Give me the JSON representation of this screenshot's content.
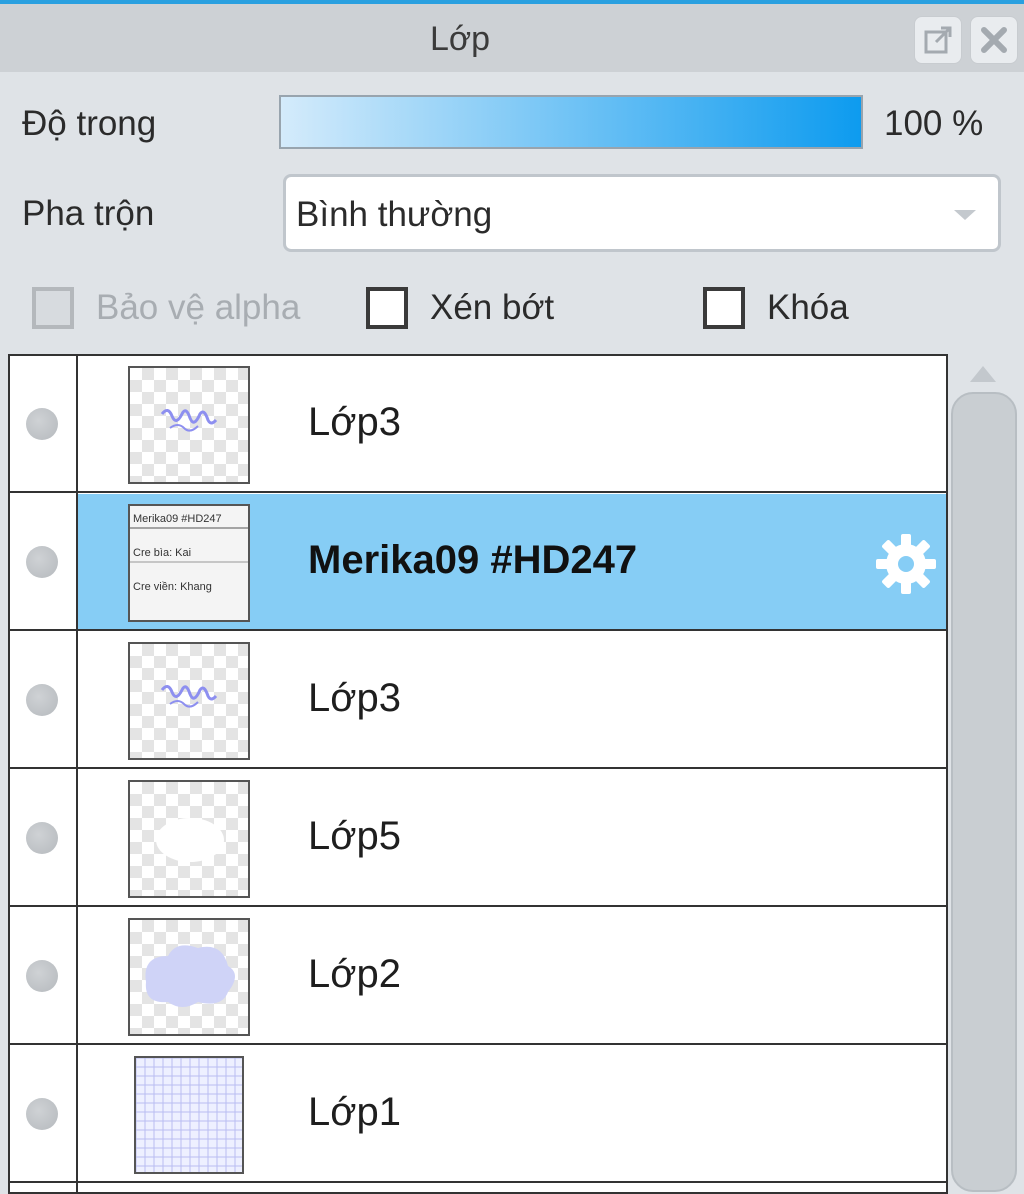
{
  "panel": {
    "title": "Lớp"
  },
  "opacity": {
    "label": "Độ trong",
    "value": 100,
    "value_text": "100 %"
  },
  "blend": {
    "label": "Pha trộn",
    "value": "Bình thường"
  },
  "options": [
    {
      "label": "Bảo vệ alpha",
      "checked": false,
      "enabled": false
    },
    {
      "label": "Xén bớt",
      "checked": false,
      "enabled": true
    },
    {
      "label": "Khóa",
      "checked": false,
      "enabled": true
    }
  ],
  "layers": [
    {
      "name": "Lớp3",
      "selected": false,
      "thumb": "scribble"
    },
    {
      "name": "Merika09 #HD247",
      "selected": true,
      "thumb": "text",
      "thumb_lines": [
        "Merika09 #HD247",
        "Cre bìa: Kai",
        "Cre viền: Khang"
      ]
    },
    {
      "name": "Lớp3",
      "selected": false,
      "thumb": "scribble"
    },
    {
      "name": "Lớp5",
      "selected": false,
      "thumb": "white-blob"
    },
    {
      "name": "Lớp2",
      "selected": false,
      "thumb": "cloud"
    },
    {
      "name": "Lớp1",
      "selected": false,
      "thumb": "grid"
    }
  ],
  "colors": {
    "accent": "#0d9bef",
    "selection": "#86cdf5",
    "panel_bg": "#dfe3e7"
  }
}
